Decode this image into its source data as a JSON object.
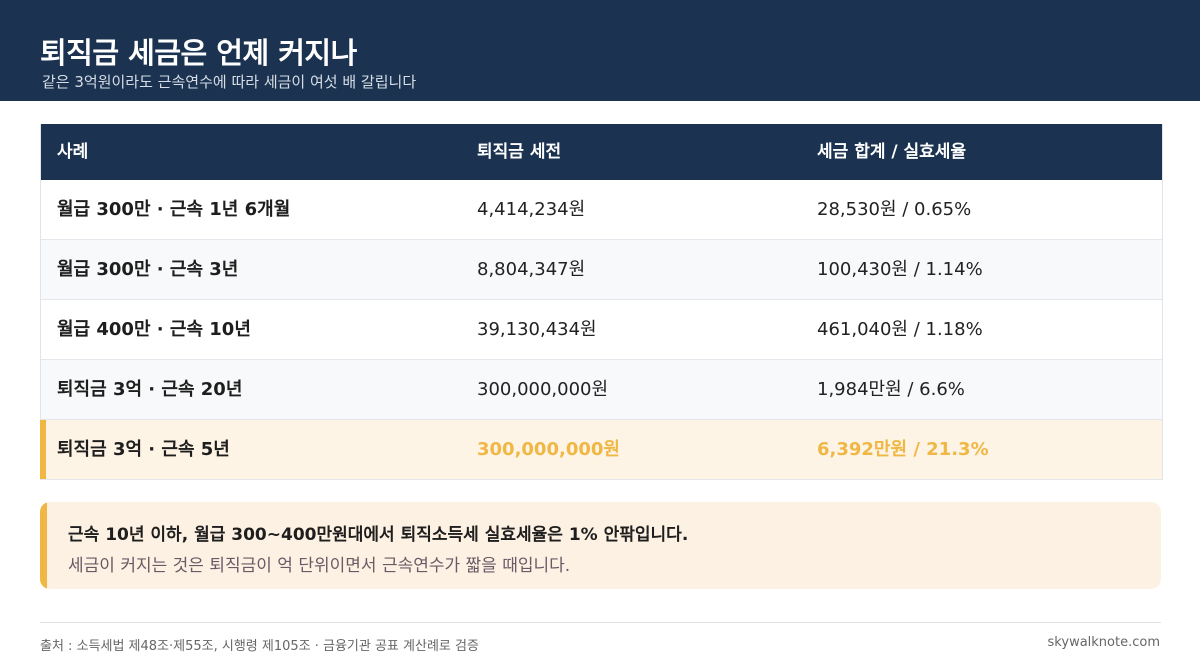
{
  "header": {
    "title": "퇴직금 세금은 언제 커지나",
    "subtitle": "같은 3억원이라도 근속연수에 따라 세금이 여섯 배 갈립니다"
  },
  "table": {
    "columns": [
      "사례",
      "퇴직금 세전",
      "세금 합계 / 실효세율"
    ],
    "rows": [
      {
        "case": "월급 300만 · 근속 1년 6개월",
        "pretax": "4,414,234원",
        "tax": "28,530원 / 0.65%"
      },
      {
        "case": "월급 300만 · 근속 3년",
        "pretax": "8,804,347원",
        "tax": "100,430원 / 1.14%"
      },
      {
        "case": "월급 400만 · 근속 10년",
        "pretax": "39,130,434원",
        "tax": "461,040원 / 1.18%"
      },
      {
        "case": "퇴직금 3억 · 근속 20년",
        "pretax": "300,000,000원",
        "tax": "1,984만원 / 6.6%"
      },
      {
        "case": "퇴직금 3억 · 근속 5년",
        "pretax": "300,000,000원",
        "tax": "6,392만원 / 21.3%"
      }
    ]
  },
  "note": {
    "line1": "근속 10년 이하, 월급 300~400만원대에서 퇴직소득세 실효세율은 1% 안팎입니다.",
    "line2": "세금이 커지는 것은 퇴직금이 억 단위이면서 근속연수가 짧을 때입니다."
  },
  "footer": {
    "source": "출처 : 소득세법 제48조·제55조, 시행령 제105조 · 금융기관 공표 계산례로 검증",
    "brand": "skywalknote.com"
  },
  "colors": {
    "navy": "#1b3350",
    "highlight": "#f0b744",
    "note_bg": "#fdf1e3"
  }
}
